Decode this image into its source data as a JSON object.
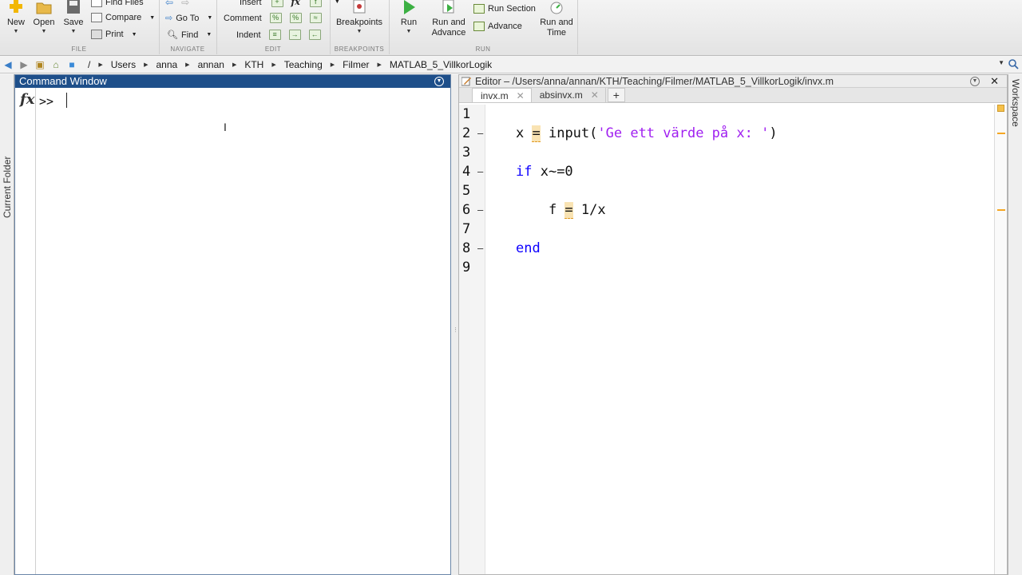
{
  "toolstrip": {
    "file": {
      "section_label": "FILE",
      "new": "New",
      "open": "Open",
      "save": "Save",
      "find_files": "Find Files",
      "compare": "Compare",
      "print": "Print"
    },
    "navigate": {
      "section_label": "NAVIGATE",
      "go_to": "Go To",
      "find": "Find"
    },
    "edit": {
      "section_label": "EDIT",
      "insert": "Insert",
      "comment": "Comment",
      "indent": "Indent"
    },
    "breakpoints": {
      "section_label": "BREAKPOINTS",
      "breakpoints": "Breakpoints"
    },
    "run": {
      "section_label": "RUN",
      "run": "Run",
      "run_and_advance_1": "Run and",
      "run_and_advance_2": "Advance",
      "run_section": "Run Section",
      "advance": "Advance",
      "run_and_time_1": "Run and",
      "run_and_time_2": "Time"
    }
  },
  "address": {
    "path": [
      "/",
      "Users",
      "anna",
      "annan",
      "KTH",
      "Teaching",
      "Filmer",
      "MATLAB_5_VillkorLogik"
    ]
  },
  "side_tabs": {
    "left": "Current Folder",
    "right": "Workspace"
  },
  "command_window": {
    "title": "Command Window",
    "fx": "fx",
    "prompt": ">>"
  },
  "editor": {
    "title": "Editor – /Users/anna/annan/KTH/Teaching/Filmer/MATLAB_5_VillkorLogik/invx.m",
    "tabs": [
      {
        "label": "invx.m",
        "active": true
      },
      {
        "label": "absinvx.m",
        "active": false
      }
    ],
    "add_tab": "+",
    "lines": [
      {
        "n": "1",
        "dash": "",
        "segments": []
      },
      {
        "n": "2",
        "dash": "–",
        "segments": [
          {
            "t": "x ",
            "c": ""
          },
          {
            "t": "=",
            "c": "warn"
          },
          {
            "t": " input(",
            "c": ""
          },
          {
            "t": "'Ge ett värde på x: '",
            "c": "str"
          },
          {
            "t": ")",
            "c": ""
          }
        ]
      },
      {
        "n": "3",
        "dash": "",
        "segments": []
      },
      {
        "n": "4",
        "dash": "–",
        "segments": [
          {
            "t": "if",
            "c": "kw"
          },
          {
            "t": " x~=0",
            "c": ""
          }
        ]
      },
      {
        "n": "5",
        "dash": "",
        "segments": []
      },
      {
        "n": "6",
        "dash": "–",
        "segments": [
          {
            "t": "    f ",
            "c": ""
          },
          {
            "t": "=",
            "c": "warn"
          },
          {
            "t": " 1/x",
            "c": ""
          }
        ]
      },
      {
        "n": "7",
        "dash": "",
        "segments": []
      },
      {
        "n": "8",
        "dash": "–",
        "segments": [
          {
            "t": "end",
            "c": "kw"
          }
        ]
      },
      {
        "n": "9",
        "dash": "",
        "segments": []
      }
    ]
  },
  "colors": {
    "command_title_bg": "#1e4f8a",
    "keyword": "#0e00ff",
    "string": "#a020f0",
    "warning_mark": "#f5a623"
  }
}
